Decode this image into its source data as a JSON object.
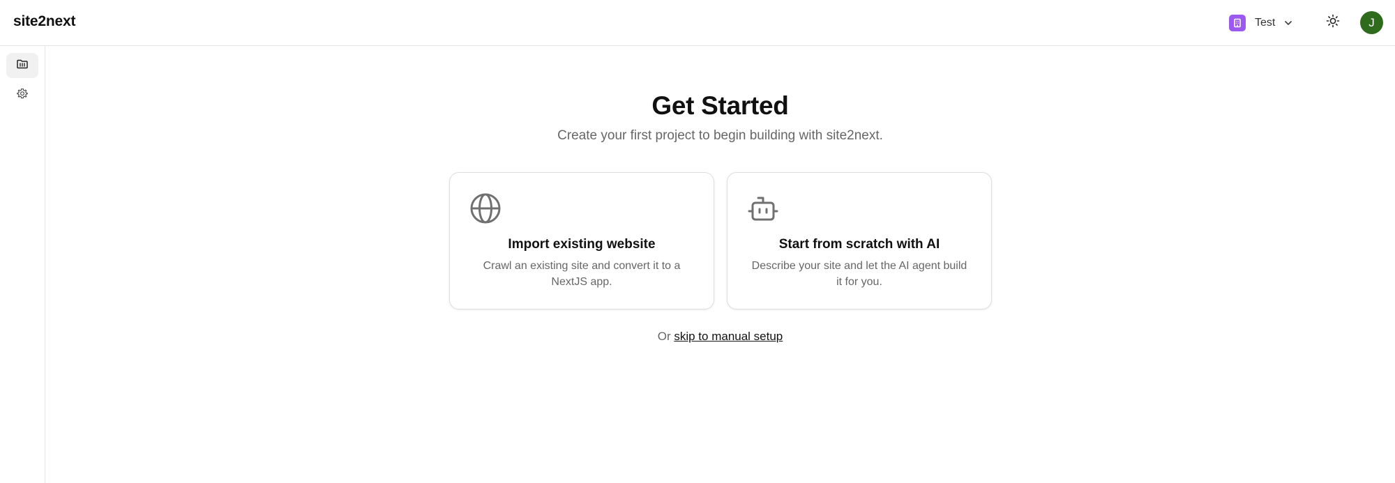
{
  "app": {
    "brand": "site2next"
  },
  "header": {
    "workspace": {
      "name": "Test",
      "icon": "building-icon",
      "color": "#9b59f0"
    },
    "theme_toggle_icon": "sun-icon",
    "avatar": {
      "initial": "J",
      "color": "#2f6b1d"
    }
  },
  "sidebar": {
    "items": [
      {
        "icon": "folder-icon",
        "active": true
      },
      {
        "icon": "gear-icon",
        "active": false
      }
    ]
  },
  "main": {
    "title": "Get Started",
    "subtitle": "Create your first project to begin building with site2next.",
    "cards": [
      {
        "icon": "globe-icon",
        "title": "Import existing website",
        "description": "Crawl an existing site and convert it to a NextJS app."
      },
      {
        "icon": "robot-icon",
        "title": "Start from scratch with AI",
        "description": "Describe your site and let the AI agent build it for you."
      }
    ],
    "skip": {
      "prefix": "Or",
      "link": "skip to manual setup"
    }
  }
}
